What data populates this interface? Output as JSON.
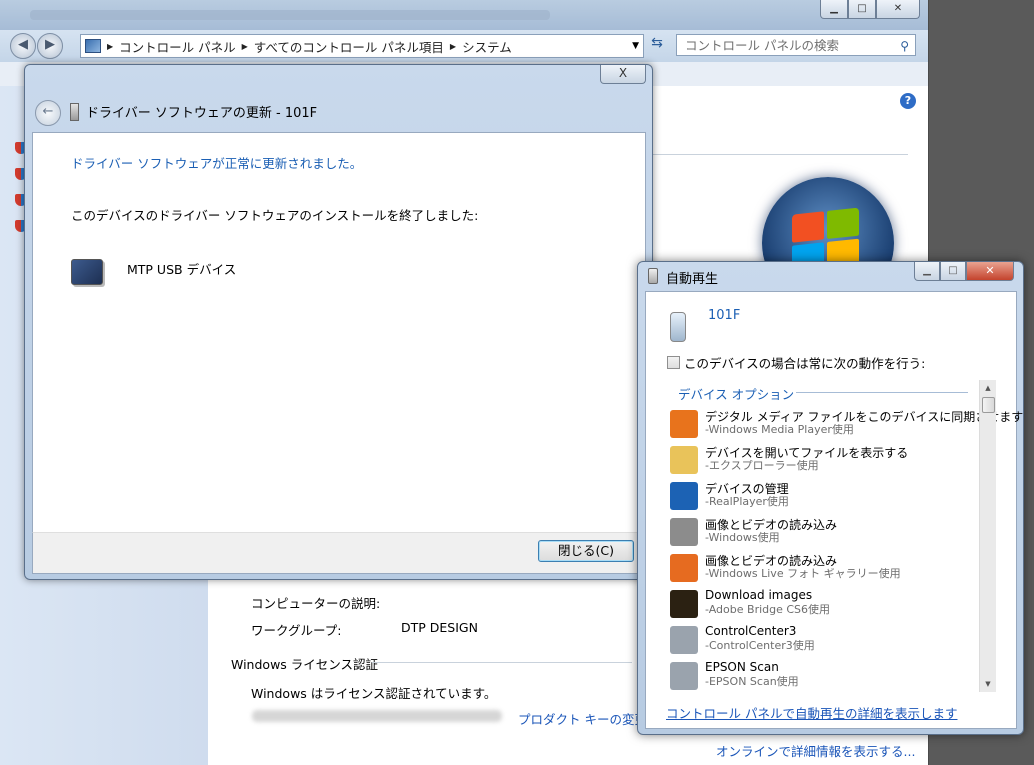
{
  "explorer": {
    "breadcrumb": [
      "コントロール パネル",
      "すべてのコントロール パネル項目",
      "システム"
    ],
    "search_placeholder": "コントロール パネルの検索",
    "help_label": "?",
    "rows": [
      {
        "label": "コンピューターの説明:",
        "value": ""
      },
      {
        "label": "ワークグループ:",
        "value": "DTP DESIGN"
      }
    ],
    "license_section": "Windows ライセンス認証",
    "license_status": "Windows はライセンス認証されています。",
    "product_key_link": "プロダクト キーの変更",
    "online_link": "オンラインで詳細情報を表示する..."
  },
  "driver_dialog": {
    "close_x": "X",
    "title": "ドライバー ソフトウェアの更新 - 101F",
    "success": "ドライバー ソフトウェアが正常に更新されました。",
    "message": "このデバイスのドライバー ソフトウェアのインストールを終了しました:",
    "device": "MTP USB デバイス",
    "close_button": "閉じる(C)"
  },
  "autoplay": {
    "title": "自動再生",
    "device": "101F",
    "checkbox_label": "このデバイスの場合は常に次の動作を行う:",
    "checkbox_checked": false,
    "group_title": "デバイス オプション",
    "options": [
      {
        "title": "デジタル メディア ファイルをこのデバイスに同期させます",
        "sub": "-Windows Media Player使用",
        "icon": "media-player-icon",
        "color": "#e8731c"
      },
      {
        "title": "デバイスを開いてファイルを表示する",
        "sub": "-エクスプローラー使用",
        "icon": "folder-icon",
        "color": "#e9c35a"
      },
      {
        "title": "デバイスの管理",
        "sub": "-RealPlayer使用",
        "icon": "realplayer-icon",
        "color": "#1c62b4"
      },
      {
        "title": "画像とビデオの読み込み",
        "sub": "-Windows使用",
        "icon": "camera-icon",
        "color": "#8c8c8c"
      },
      {
        "title": "画像とビデオの読み込み",
        "sub": "-Windows Live フォト ギャラリー使用",
        "icon": "photo-gallery-icon",
        "color": "#e66b20"
      },
      {
        "title": "Download images",
        "sub": "-Adobe Bridge CS6使用",
        "icon": "adobe-bridge-icon",
        "color": "#2b2112"
      },
      {
        "title": "ControlCenter3",
        "sub": "-ControlCenter3使用",
        "icon": "scanner-icon",
        "color": "#9aa3ad"
      },
      {
        "title": "EPSON Scan",
        "sub": "-EPSON Scan使用",
        "icon": "scanner-icon",
        "color": "#9aa3ad"
      }
    ],
    "footer_link": "コントロール パネルで自動再生の詳細を表示します"
  }
}
